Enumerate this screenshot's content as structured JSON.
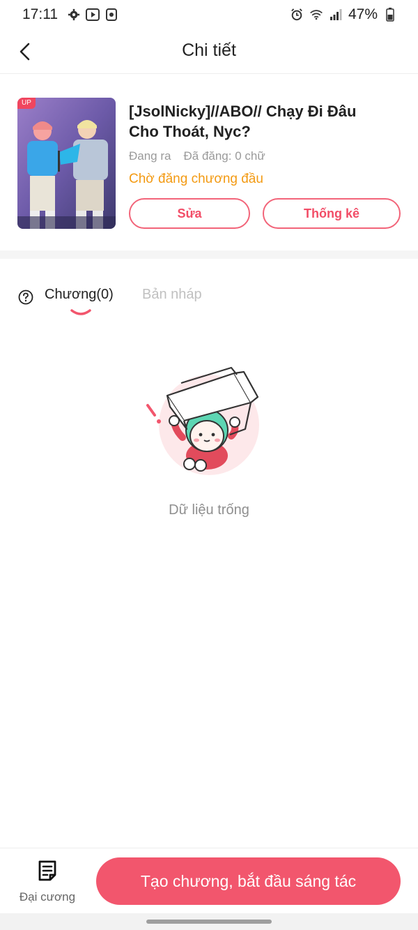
{
  "status_bar": {
    "time": "17:11",
    "battery": "47%",
    "left_icons": [
      "gear-icon",
      "youtube-icon",
      "media-icon"
    ],
    "right_icons": [
      "alarm-icon",
      "wifi-icon",
      "signal-icon",
      "battery-icon"
    ]
  },
  "header": {
    "title": "Chi tiết",
    "back_icon": "chevron-left-icon"
  },
  "book": {
    "badge": "UP",
    "title": "[JsolNicky]//ABO// Chạy Đi Đâu Cho Thoát, Nyc?",
    "state": "Đang ra",
    "word_count": "Đã đăng: 0 chữ",
    "status": "Chờ đăng chương đầu",
    "edit_label": "Sửa",
    "stats_label": "Thống kê"
  },
  "tabs": {
    "chapters_label": "Chương(0)",
    "drafts_label": "Bản nháp",
    "active": "chapters"
  },
  "empty_state": {
    "text": "Dữ liệu trống"
  },
  "bottom_bar": {
    "outline_label": "Đại cương",
    "create_label": "Tạo chương, bắt đầu sáng tác"
  },
  "colors": {
    "accent": "#f2566d",
    "status_orange": "#f39a12",
    "muted": "#9a9a9a"
  }
}
